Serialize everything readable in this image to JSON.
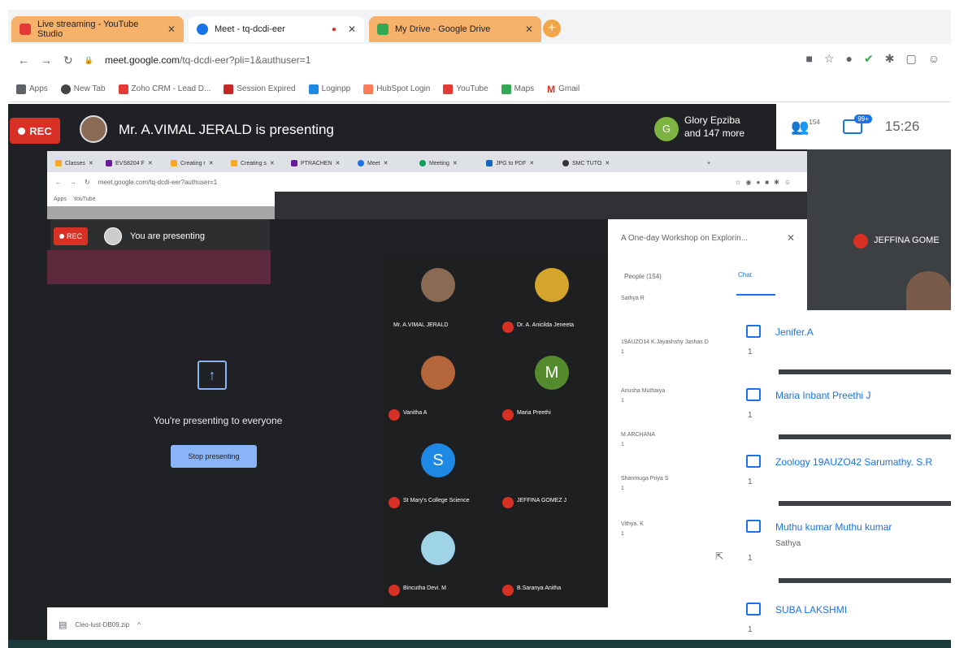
{
  "browser": {
    "tabs": [
      {
        "label": "Live streaming - YouTube Studio",
        "color": "#e53935",
        "bg": "#f6b26b"
      },
      {
        "label": "Meet - tq-dcdi-eer",
        "color": "#1a73e8",
        "bg": "#ffffff"
      },
      {
        "label": "My Drive - Google Drive",
        "color": "#34a853",
        "bg": "#f6b26b"
      }
    ],
    "new_tab": "+",
    "url_host": "meet.google.com",
    "url_path": "/tq-dcdi-eer?pli=1&authuser=1",
    "bookmarks": [
      "Apps",
      "New Tab",
      "Zoho CRM - Lead D...",
      "Session Expired",
      "Loginpp",
      "HubSpot Login",
      "YouTube",
      "Maps",
      "Gmail"
    ]
  },
  "meet": {
    "rec": "REC",
    "presenting_banner": "Mr. A.VIMAL JERALD is presenting",
    "others": {
      "initial": "G",
      "line1": "Glory Epziba",
      "line2": "and 147 more"
    },
    "people_count": "154",
    "chat_badge": "99+",
    "clock": "15:26",
    "corner_tile_name": "JEFFINA GOME"
  },
  "inner": {
    "tabs": [
      "Classes",
      "EVS8204 F",
      "Creating r",
      "Creating s",
      "PTRACHEN",
      "Meet",
      "Meeting",
      "JPG to PDF",
      "SMC TUTO"
    ],
    "url": "meet.google.com/tq-dcdi-eer?authuser=1",
    "bookmarks": [
      "Apps",
      "YouTube"
    ],
    "rec": "REC",
    "you_presenting": "You are presenting",
    "present_msg": "You're presenting to everyone",
    "stop_btn": "Stop presenting",
    "tiles": [
      {
        "name": "Mr. A.VIMAL JERALD",
        "initial": "",
        "color": "#8a6a55"
      },
      {
        "name": "Dr. A. Anicilda Jeneeta",
        "initial": "",
        "color": "#d4a52a"
      },
      {
        "name": "Vanitha A",
        "initial": "",
        "color": "#b5653a"
      },
      {
        "name": "Maria Preethi",
        "initial": "M",
        "color": "#558b2f"
      },
      {
        "name": "St Mary's College Science",
        "initial": "S",
        "color": "#1e88e5"
      },
      {
        "name": "JEFFINA GOMEZ J",
        "initial": "",
        "color": "#bfb8ae"
      },
      {
        "name": "Bincutha Devi. M",
        "initial": "",
        "color": "#9fd3e8"
      },
      {
        "name": "B.Saranya Anitha",
        "initial": "",
        "color": "#bfb8ae"
      }
    ],
    "panel_title": "A One-day Workshop on Explorin...",
    "panel_people": "People (154)",
    "panel_chat": "Chat",
    "panel_msgs": [
      {
        "name": "Sathya R",
        "count": ""
      },
      {
        "name": "19AUZO14 K.Jayashshy Jashas D",
        "count": "1"
      },
      {
        "name": "Anusha Muthaiya",
        "count": "1"
      },
      {
        "name": "M.ARCHANA",
        "count": "1"
      },
      {
        "name": "Shanmuga Priya S",
        "count": "1"
      },
      {
        "name": "Vithya. K",
        "count": "1"
      }
    ]
  },
  "chat": [
    {
      "name": "Jenifer.A",
      "text": "",
      "count": "1"
    },
    {
      "name": "Maria Inbant Preethi J",
      "text": "",
      "count": "1"
    },
    {
      "name": "Zoology 19AUZO42 Sarumathy. S.R",
      "text": "",
      "count": "1"
    },
    {
      "name": "Muthu kumar Muthu kumar",
      "text": "Sathya",
      "count": "1"
    },
    {
      "name": "SUBA LAKSHMI",
      "text": "",
      "count": "1"
    }
  ],
  "download": {
    "file": "Cleo-lust-DB09.zip",
    "chevron": "^"
  }
}
